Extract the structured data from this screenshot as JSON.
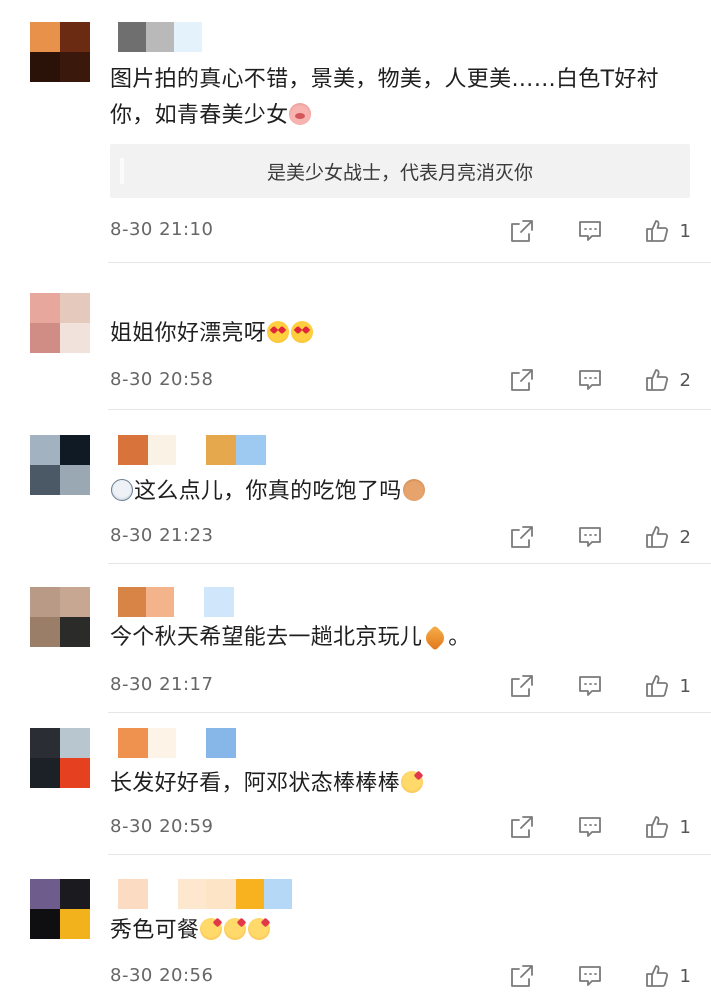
{
  "comments": [
    {
      "avatar_colors": [
        "#e8914a",
        "#6b2a12",
        "#2a1208",
        "#3a190c"
      ],
      "name_colors": [
        "#6f6f6f",
        "#b9b9b9",
        "#e4f2fb"
      ],
      "text": "图片拍的真心不错，景美，物美，人更美……白色T好衬你，如青春美少女",
      "emojis": [
        "pig"
      ],
      "reply": "是美少女战士，代表月亮消灭你",
      "time": "8-30 21:10",
      "likes": "1"
    },
    {
      "avatar_colors": [
        "#e8a79c",
        "#e6c9bd",
        "#cf8d86",
        "#f1e2dc"
      ],
      "name_colors": [],
      "text": "姐姐你好漂亮呀",
      "emojis": [
        "heart-eyes",
        "heart-eyes"
      ],
      "reply": "",
      "time": "8-30 20:58",
      "likes": "2"
    },
    {
      "avatar_colors": [
        "#a3b2c0",
        "#0f1a25",
        "#4b5866",
        "#9aa8b4"
      ],
      "name_colors": [
        "#d8743b",
        "#fbf2e6",
        "#ffffff",
        "#e6a84c",
        "#9ec9f0"
      ],
      "text": "这么点儿，你真的吃饱了吗",
      "emojis": [
        "doge"
      ],
      "prefix_emoji": "cry",
      "reply": "",
      "time": "8-30 21:23",
      "likes": "2"
    },
    {
      "avatar_colors": [
        "#b89a86",
        "#c7a792",
        "#9b7e68",
        "#2b2c2a"
      ],
      "name_colors": [
        "#d98447",
        "#f3b48b",
        "#ffffff",
        "#cfe6fb"
      ],
      "text": "今个秋天希望能去一趟北京玩儿",
      "suffix": "。",
      "emojis": [
        "leaf"
      ],
      "reply": "",
      "time": "8-30 21:17",
      "likes": "1"
    },
    {
      "avatar_colors": [
        "#2a2d33",
        "#b8c7cf",
        "#1c2128",
        "#e5401f"
      ],
      "name_colors": [
        "#f0924f",
        "#fdf3e6",
        "#ffffff",
        "#86b7e8"
      ],
      "text": "长发好好看，阿邓状态棒棒棒",
      "emojis": [
        "kiss"
      ],
      "reply": "",
      "time": "8-30 20:59",
      "likes": "1"
    },
    {
      "avatar_colors": [
        "#6e5c8c",
        "#1b1a1f",
        "#0f0f12",
        "#f2b21c"
      ],
      "name_colors": [
        "#fbdcc2",
        "#ffffff",
        "#fde7cf",
        "#fde4c6",
        "#f9b21f",
        "#b4d8f5"
      ],
      "text": "秀色可餐",
      "emojis": [
        "kiss",
        "kiss",
        "kiss"
      ],
      "reply": "",
      "time": "8-30 20:56",
      "likes": "1"
    }
  ],
  "icons": {
    "share": "share-icon",
    "comment": "comment-icon",
    "like": "thumbs-up-icon"
  },
  "colors": {
    "text": "#1f1f1f",
    "meta": "#666666",
    "reply_bg": "#f2f2f2",
    "icon": "#7a7a7a"
  }
}
